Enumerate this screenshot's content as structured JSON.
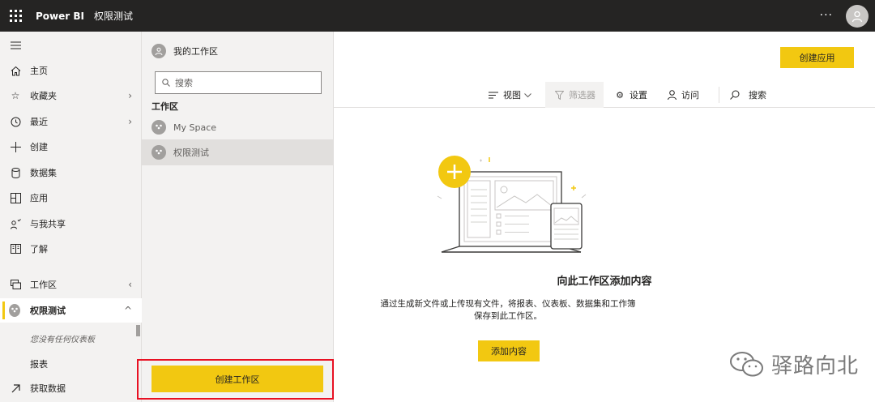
{
  "topbar": {
    "brand": "Power BI",
    "workspace_title": "权限测试",
    "more_label": "···"
  },
  "nav": {
    "items": [
      {
        "label": "主页",
        "icon": "home-icon"
      },
      {
        "label": "收藏夹",
        "icon": "star-icon"
      },
      {
        "label": "最近",
        "icon": "clock-icon"
      },
      {
        "label": "创建",
        "icon": "plus-icon"
      },
      {
        "label": "数据集",
        "icon": "database-icon"
      },
      {
        "label": "应用",
        "icon": "apps-icon"
      },
      {
        "label": "与我共享",
        "icon": "share-icon"
      },
      {
        "label": "了解",
        "icon": "book-icon"
      },
      {
        "label": "工作区",
        "icon": "workspaces-icon"
      },
      {
        "label": "权限测试",
        "icon": "workspace-avatar-icon"
      }
    ],
    "empty_dashboards": "您没有任何仪表板",
    "reports_label": "报表",
    "get_data_label": "获取数据"
  },
  "flyout": {
    "my_workspace": "我的工作区",
    "search_placeholder": "搜索",
    "section_title": "工作区",
    "workspaces": [
      "My Space",
      "权限测试"
    ],
    "create_workspace_label": "创建工作区"
  },
  "main": {
    "create_app_label": "创建应用",
    "toolbar": {
      "view_label": "视图",
      "filter_label": "筛选器",
      "settings_label": "设置",
      "access_label": "访问",
      "search_label": "搜索"
    },
    "empty_title": "向此工作区添加内容",
    "empty_desc_line1": "通过生成新文件或上传现有文件，将报表、仪表板、数据集和工作簿",
    "empty_desc_line2": "保存到此工作区。",
    "add_content_label": "添加内容"
  },
  "watermark": {
    "text": "驿路向北"
  },
  "colors": {
    "accent": "#f2c811",
    "topbar": "#252423",
    "highlight_border": "#e81123"
  }
}
